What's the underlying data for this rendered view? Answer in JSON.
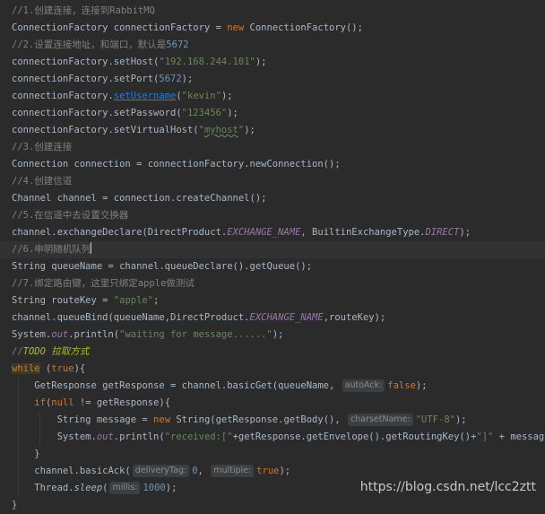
{
  "lines": [
    [
      {
        "c": "cm",
        "t": "//1.创建连接，连接到RabbitMQ"
      }
    ],
    [
      {
        "t": "ConnectionFactory connectionFactory = "
      },
      {
        "c": "kw",
        "t": "new "
      },
      {
        "t": "ConnectionFactory();"
      }
    ],
    [
      {
        "c": "cm",
        "t": "//2.设置连接地址，和端口，默认是"
      },
      {
        "c": "num",
        "t": "5672"
      }
    ],
    [
      {
        "t": "connectionFactory.setHost("
      },
      {
        "c": "str",
        "t": "\"192.168.244.101\""
      },
      {
        "t": ");"
      }
    ],
    [
      {
        "t": "connectionFactory.setPort("
      },
      {
        "c": "num",
        "t": "5672"
      },
      {
        "t": ");"
      }
    ],
    [
      {
        "t": "connectionFactory."
      },
      {
        "c": "link",
        "t": "setUsername"
      },
      {
        "t": "("
      },
      {
        "c": "str",
        "t": "\"kevin\""
      },
      {
        "t": ");"
      }
    ],
    [
      {
        "t": "connectionFactory.setPassword("
      },
      {
        "c": "str",
        "t": "\"123456\""
      },
      {
        "t": ");"
      }
    ],
    [
      {
        "t": "connectionFactory.setVirtualHost("
      },
      {
        "c": "str",
        "t": "\""
      },
      {
        "c": "str-wavy",
        "t": "myhost"
      },
      {
        "c": "str",
        "t": "\""
      },
      {
        "t": ");"
      }
    ],
    [
      {
        "c": "cm",
        "t": "//3.创建连接"
      }
    ],
    [
      {
        "t": "Connection connection = connectionFactory.newConnection();"
      }
    ],
    [
      {
        "c": "cm",
        "t": "//4.创建信道"
      }
    ],
    [
      {
        "t": "Channel channel = connection.createChannel();"
      }
    ],
    [
      {
        "c": "cm",
        "t": "//5.在信道中去设置交换器"
      }
    ],
    [
      {
        "t": "channel.exchangeDeclare(DirectProduct."
      },
      {
        "c": "fld",
        "t": "EXCHANGE_NAME"
      },
      {
        "t": ", BuiltinExchangeType."
      },
      {
        "c": "fld",
        "t": "DIRECT"
      },
      {
        "t": ");"
      }
    ],
    [
      {
        "c": "cm",
        "t": "//6.申明随机队列"
      },
      {
        "c": "cursor",
        "t": ""
      }
    ],
    [
      {
        "t": "String queueName = channel.queueDeclare().getQueue();"
      }
    ],
    [
      {
        "c": "cm",
        "t": "//7.绑定路由键，这里只绑定apple做测试"
      }
    ],
    [
      {
        "t": "String routeKey = "
      },
      {
        "c": "str",
        "t": "\"apple\""
      },
      {
        "t": ";"
      }
    ],
    [
      {
        "t": "channel.queueBind(queueName,DirectProduct."
      },
      {
        "c": "fld",
        "t": "EXCHANGE_NAME"
      },
      {
        "t": ",routeKey);"
      }
    ],
    [
      {
        "t": "System."
      },
      {
        "c": "fld",
        "t": "out"
      },
      {
        "t": ".println("
      },
      {
        "c": "str",
        "t": "\"waiting for message......\""
      },
      {
        "t": ");"
      }
    ],
    [
      {
        "c": "cm",
        "t": "//"
      },
      {
        "c": "todo",
        "t": "TODO 拉取方式"
      }
    ],
    [
      {
        "c": "kwhl",
        "t": "while"
      },
      {
        "t": " ("
      },
      {
        "c": "kw",
        "t": "true"
      },
      {
        "t": "){"
      }
    ],
    [
      {
        "t": "    GetResponse getResponse = channel.basicGet(queueName, "
      },
      {
        "c": "hint",
        "t": "autoAck:"
      },
      {
        "c": "kw",
        "t": "false"
      },
      {
        "t": ");"
      }
    ],
    [
      {
        "t": "    "
      },
      {
        "c": "kw",
        "t": "if"
      },
      {
        "t": "("
      },
      {
        "c": "kw",
        "t": "null"
      },
      {
        "t": " != getResponse){"
      }
    ],
    [
      {
        "t": "        String message = "
      },
      {
        "c": "kw",
        "t": "new "
      },
      {
        "t": "String(getResponse.getBody(), "
      },
      {
        "c": "hint",
        "t": "charsetName:"
      },
      {
        "c": "str",
        "t": "\"UTF-8\""
      },
      {
        "t": ");"
      }
    ],
    [
      {
        "t": "        System."
      },
      {
        "c": "fld",
        "t": "out"
      },
      {
        "t": ".println("
      },
      {
        "c": "str",
        "t": "\"received:[\""
      },
      {
        "t": "+getResponse.getEnvelope().getRoutingKey()+"
      },
      {
        "c": "str",
        "t": "\"]\""
      },
      {
        "t": " + message);"
      }
    ],
    [
      {
        "t": "    }"
      }
    ],
    [
      {
        "t": "    channel.basicAck("
      },
      {
        "c": "hint",
        "t": "deliveryTag:"
      },
      {
        "c": "num",
        "t": "0"
      },
      {
        "t": ", "
      },
      {
        "c": "hint",
        "t": "multiple:"
      },
      {
        "c": "kw",
        "t": "true"
      },
      {
        "t": ");"
      }
    ],
    [
      {
        "t": "    Thread."
      },
      {
        "c": "static",
        "t": "sleep"
      },
      {
        "t": "("
      },
      {
        "c": "hint",
        "t": "millis:"
      },
      {
        "c": "num",
        "t": "1000"
      },
      {
        "t": ");"
      }
    ],
    [
      {
        "t": "}"
      }
    ]
  ],
  "watermark": "https://blog.csdn.net/lcc2ztt"
}
